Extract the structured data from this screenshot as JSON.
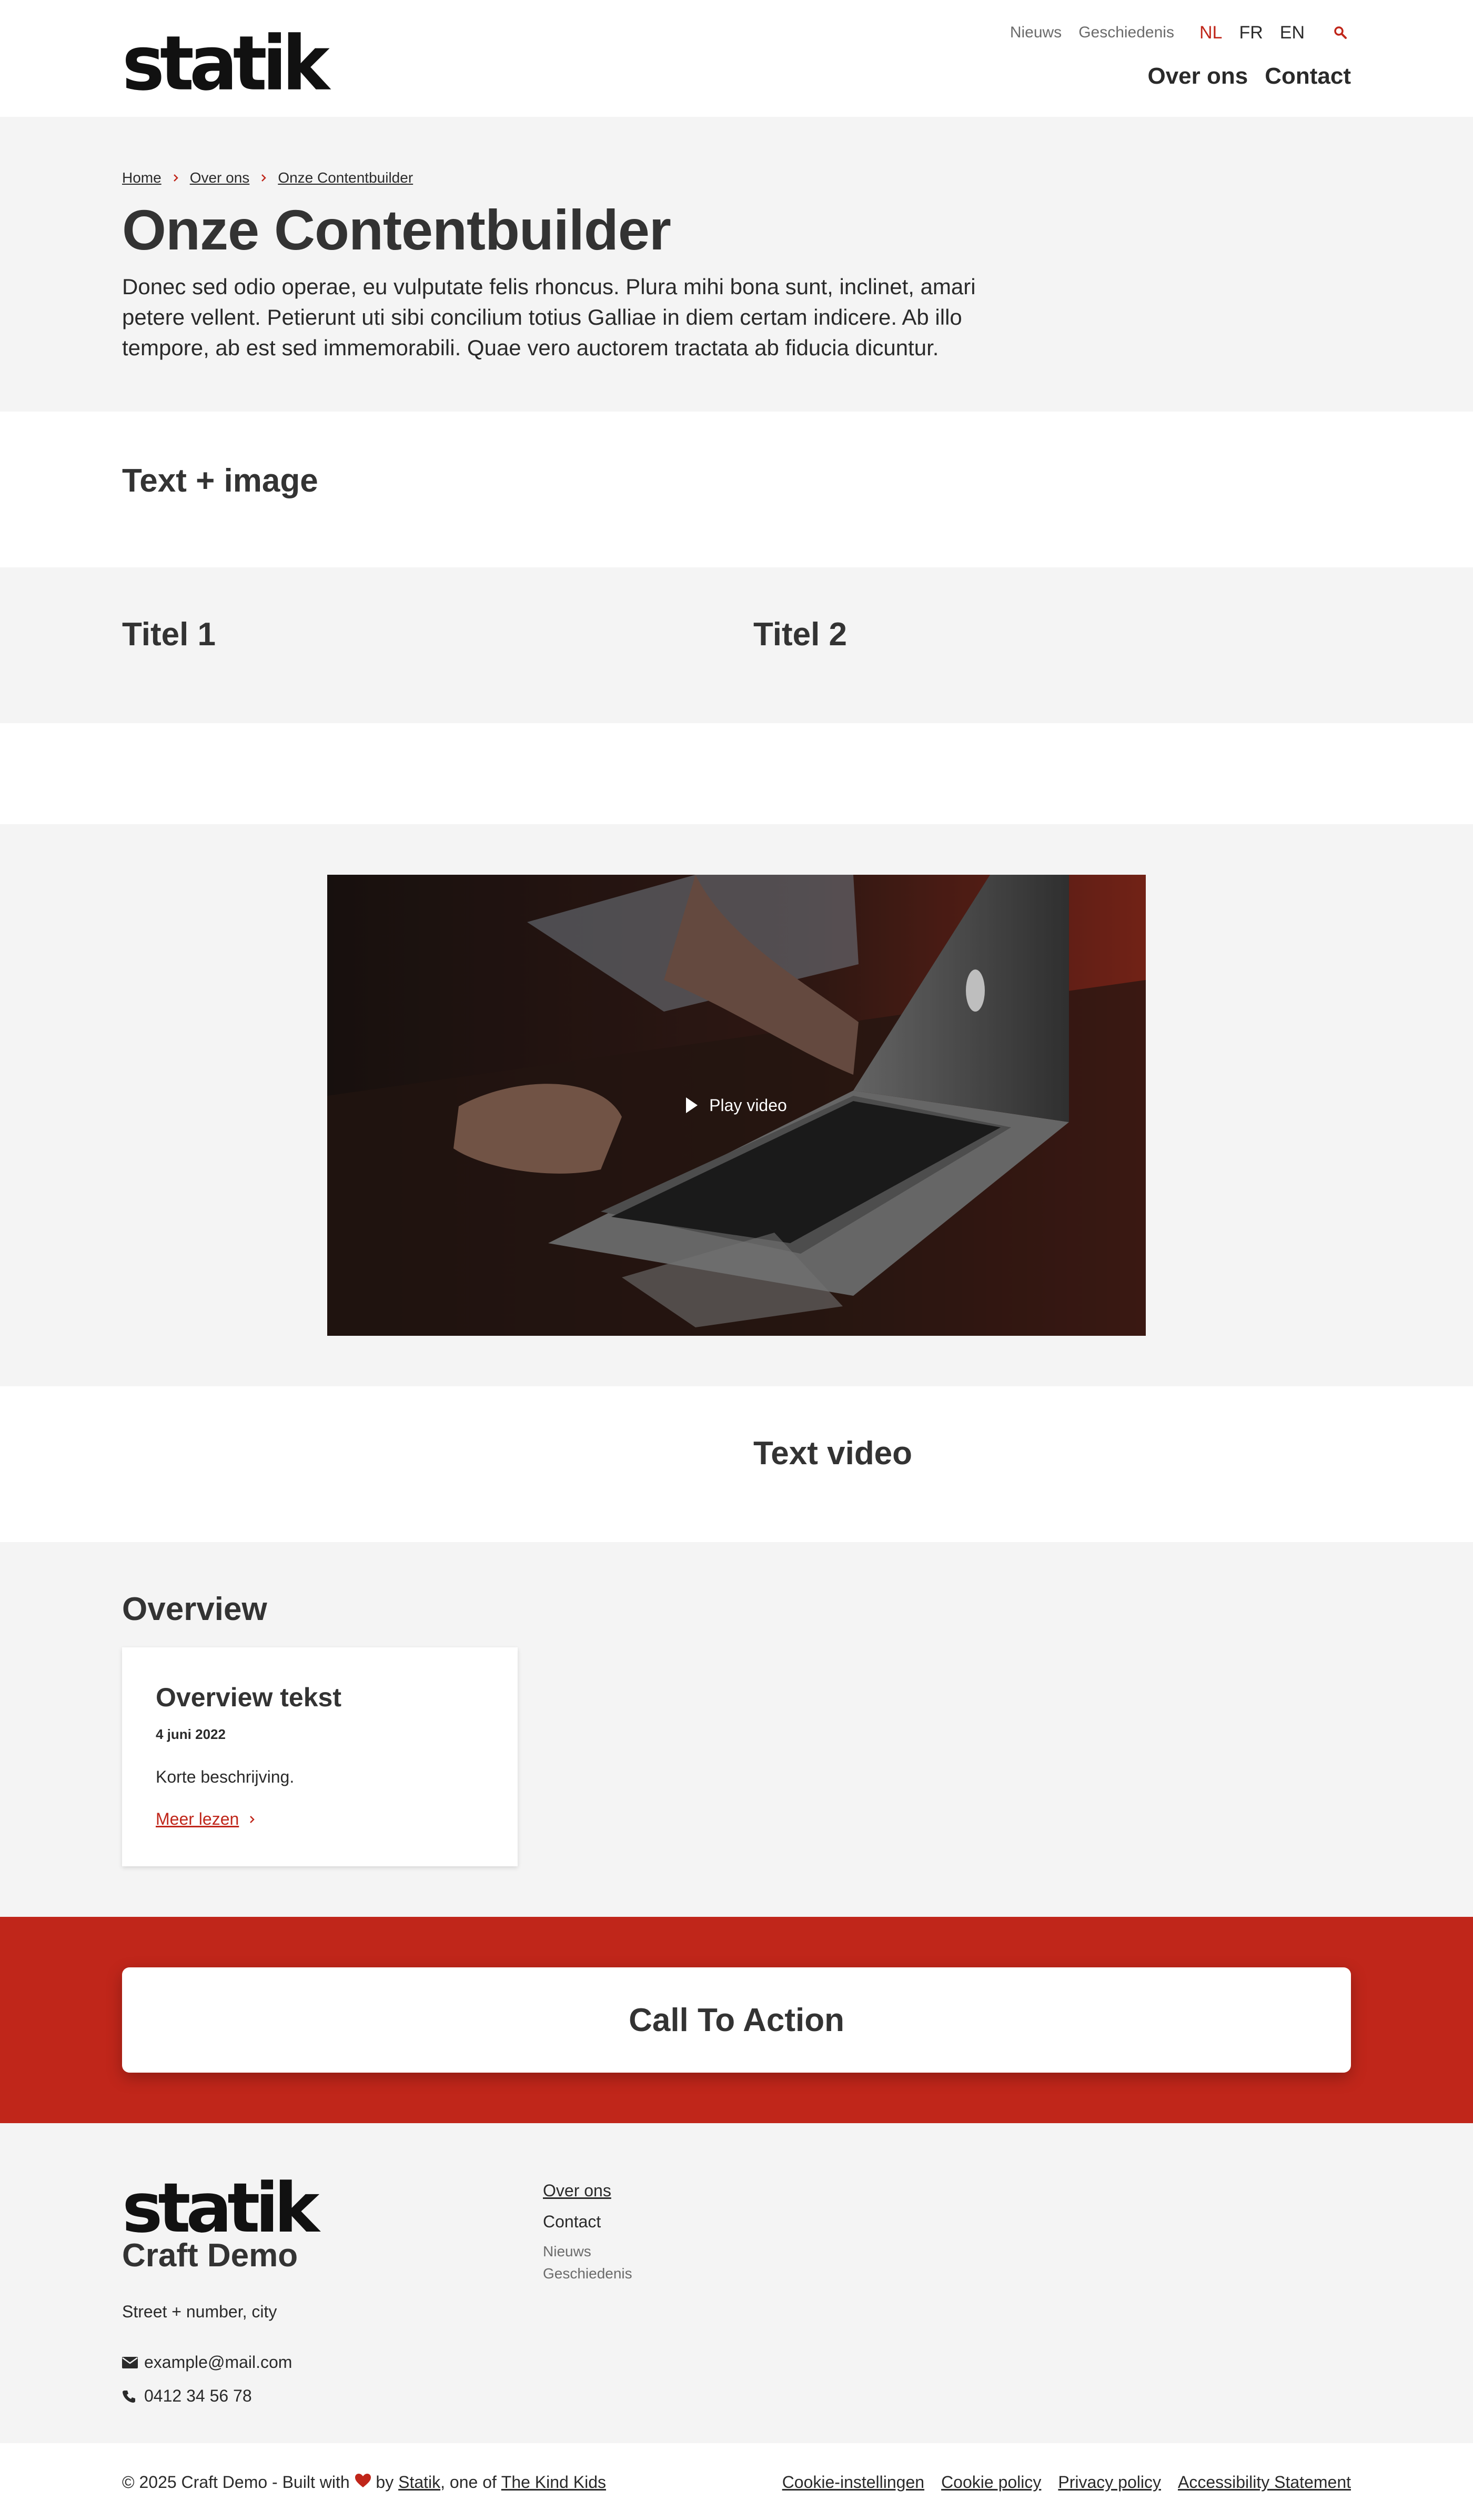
{
  "header": {
    "logo": "statik",
    "meta_nav": [
      {
        "label": "Nieuws"
      },
      {
        "label": "Geschiedenis"
      }
    ],
    "languages": [
      {
        "label": "NL",
        "active": true
      },
      {
        "label": "FR",
        "active": false
      },
      {
        "label": "EN",
        "active": false
      }
    ],
    "search_icon": "search-icon",
    "main_nav": [
      {
        "label": "Over ons"
      },
      {
        "label": "Contact"
      }
    ]
  },
  "hero": {
    "breadcrumb": [
      "Home",
      "Over ons",
      "Onze Contentbuilder"
    ],
    "title": "Onze Contentbuilder",
    "intro": "Donec sed odio operae, eu vulputate felis rhoncus. Plura mihi bona sunt, inclinet, amari petere vellent. Petierunt uti sibi concilium totius Galliae in diem certam indicere. Ab illo tempore, ab est sed immemorabili. Quae vero auctorem tractata ab fiducia dicuntur."
  },
  "sections": {
    "text_image_title": "Text + image",
    "col1_title": "Titel 1",
    "col2_title": "Titel 2",
    "video_label": "Play video",
    "text_video_title": "Text video",
    "overview_title": "Overview"
  },
  "overview_card": {
    "title": "Overview tekst",
    "date": "4 juni 2022",
    "description": "Korte beschrijving.",
    "link": "Meer lezen"
  },
  "cta": {
    "label": "Call To Action"
  },
  "footer": {
    "logo": "statik",
    "title": "Craft Demo",
    "address": "Street + number, city",
    "email": "example@mail.com",
    "phone": "0412 34 56 78",
    "nav_main": [
      {
        "label": "Over ons"
      },
      {
        "label": "Contact"
      }
    ],
    "nav_meta": [
      {
        "label": "Nieuws"
      },
      {
        "label": "Geschiedenis"
      }
    ],
    "copyright_pre": "© 2025 Craft Demo - Built with ",
    "copyright_by": " by ",
    "copyright_statik": "Statik",
    "copyright_mid": ", one of ",
    "copyright_kids": "The Kind Kids",
    "legal": [
      {
        "label": "Cookie-instellingen"
      },
      {
        "label": "Cookie policy"
      },
      {
        "label": "Privacy policy"
      },
      {
        "label": "Accessibility Statement"
      }
    ]
  },
  "colors": {
    "accent": "#c0261a",
    "grey_band": "#f4f4f4",
    "text": "#2a2a2a"
  }
}
